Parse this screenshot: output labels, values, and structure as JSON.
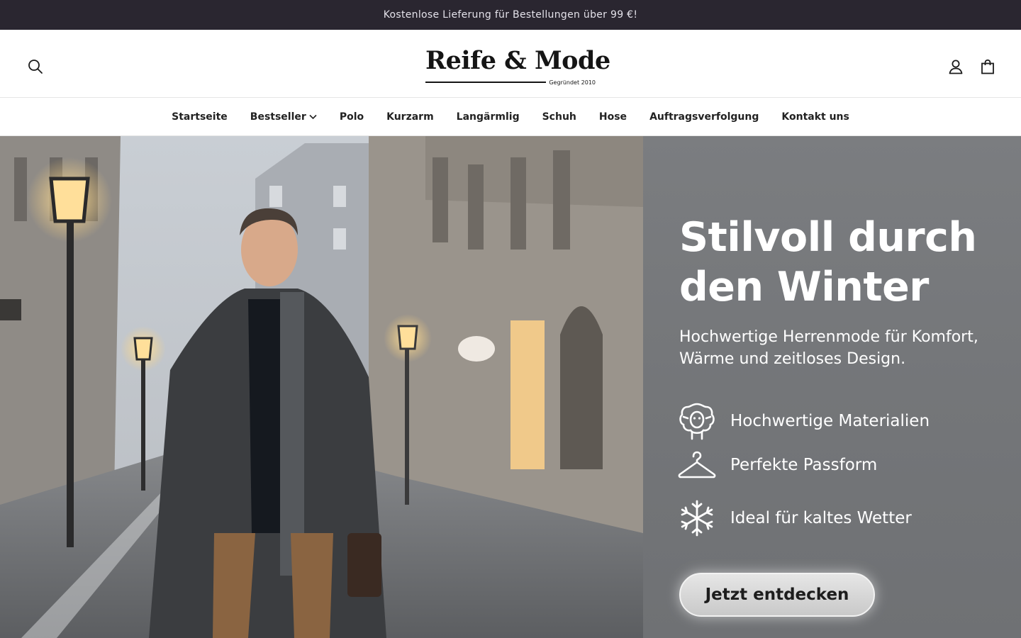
{
  "announcement": {
    "text": "Kostenlose Lieferung für Bestellungen über 99 €!"
  },
  "header": {
    "logo_name": "Reife & Mode",
    "logo_tagline": "Gegründet 2010",
    "icons": {
      "search": "search-icon",
      "account": "user-icon",
      "cart": "shopping-bag-icon"
    }
  },
  "nav": {
    "items": [
      {
        "label": "Startseite"
      },
      {
        "label": "Bestseller",
        "dropdown": true
      },
      {
        "label": "Polo"
      },
      {
        "label": "Kurzarm"
      },
      {
        "label": "Langärmlig"
      },
      {
        "label": "Schuh"
      },
      {
        "label": "Hose"
      },
      {
        "label": "Auftragsverfolgung"
      },
      {
        "label": "Kontakt uns"
      }
    ]
  },
  "hero": {
    "title_line1": "Stilvoll durch",
    "title_line2": "den Winter",
    "subtitle_line1": "Hochwertige Herrenmode für Komfort,",
    "subtitle_line2": "Wärme und zeitloses Design.",
    "features": [
      {
        "icon": "sheep-icon",
        "label": "Hochwertige Materialien"
      },
      {
        "icon": "hanger-icon",
        "label": "Perfekte Passform"
      },
      {
        "icon": "snowflake-icon",
        "label": "Ideal für kaltes Wetter"
      }
    ],
    "cta_label": "Jetzt entdecken"
  },
  "colors": {
    "announcement_bg": "#2a2630",
    "panel_bg": "#77797c",
    "cta_bg": "#d8d8d8"
  }
}
